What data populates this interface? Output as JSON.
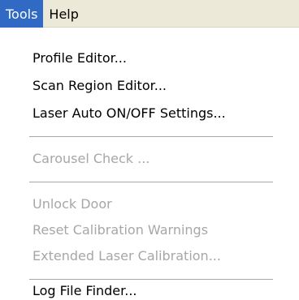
{
  "menubar": {
    "tools_label": "Tools",
    "help_label": "Help"
  },
  "tools_menu": {
    "profile_editor": "Profile Editor...",
    "scan_region_editor": "Scan Region Editor...",
    "laser_auto_settings": "Laser Auto ON/OFF Settings...",
    "carousel_check": "Carousel Check ...",
    "unlock_door": "Unlock Door",
    "reset_calibration_warnings": "Reset Calibration Warnings",
    "extended_laser_calibration": "Extended Laser Calibration...",
    "log_file_finder": "Log File Finder..."
  },
  "colors": {
    "highlight": "#316ac5",
    "disabled_text": "#a7a6aa",
    "menubar_bg": "#ece9d8"
  }
}
